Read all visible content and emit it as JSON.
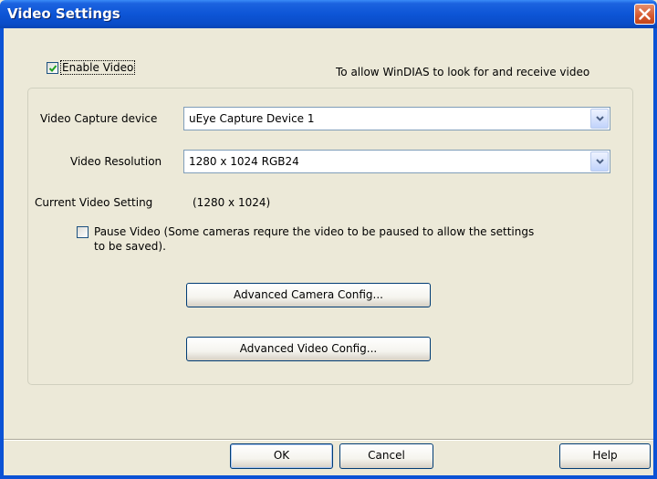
{
  "window": {
    "title": "Video Settings"
  },
  "enable_video": {
    "label": "Enable Video",
    "checked": true
  },
  "hint": "To allow WinDIAS to look for and receive video",
  "capture_device": {
    "label": "Video Capture device",
    "value": "uEye Capture Device 1"
  },
  "resolution": {
    "label": "Video Resolution",
    "value": "1280 x 1024  RGB24"
  },
  "current": {
    "label": "Current Video Setting",
    "value": "(1280 x 1024)"
  },
  "pause": {
    "line1": "Pause Video (Some cameras requre the video to be paused to allow the settings",
    "line2": "to be saved).",
    "checked": false
  },
  "buttons": {
    "camera_config": "Advanced Camera Config...",
    "video_config": "Advanced Video Config...",
    "ok": "OK",
    "cancel": "Cancel",
    "help": "Help"
  },
  "icons": {
    "close": "close-icon",
    "check": "checkmark-icon",
    "dropdown": "chevron-down-icon"
  },
  "colors": {
    "titlebar": "#0d55d6",
    "dialog_bg": "#ece9d8",
    "close_button": "#d6582e",
    "check_mark": "#21a121"
  }
}
